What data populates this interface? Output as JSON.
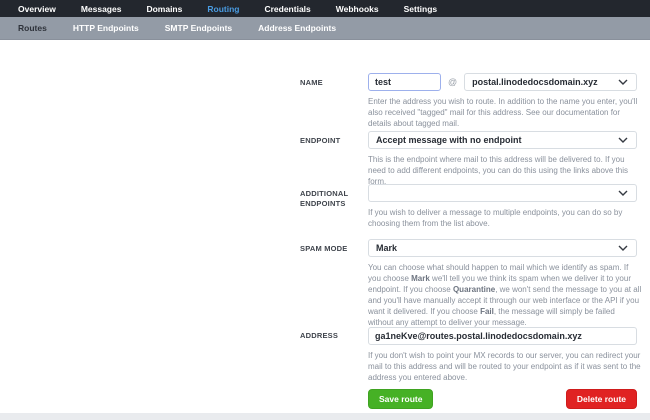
{
  "nav": {
    "tabs": [
      {
        "label": "Overview",
        "active": false
      },
      {
        "label": "Messages",
        "active": false
      },
      {
        "label": "Domains",
        "active": false
      },
      {
        "label": "Routing",
        "active": true
      },
      {
        "label": "Credentials",
        "active": false
      },
      {
        "label": "Webhooks",
        "active": false
      },
      {
        "label": "Settings",
        "active": false
      }
    ]
  },
  "subnav": {
    "items": [
      {
        "label": "Routes",
        "active": true
      },
      {
        "label": "HTTP Endpoints",
        "active": false
      },
      {
        "label": "SMTP Endpoints",
        "active": false
      },
      {
        "label": "Address Endpoints",
        "active": false
      }
    ]
  },
  "form": {
    "name": {
      "label": "NAME",
      "value": "test",
      "separator": "@",
      "domain": "postal.linodedocsdomain.xyz",
      "help": "Enter the address you wish to route. In addition to the name you enter, you'll also received \"tagged\" mail for this address. See our documentation for details about tagged mail."
    },
    "endpoint": {
      "label": "ENDPOINT",
      "value": "Accept message with no endpoint",
      "help": "This is the endpoint where mail to this address will be delivered to. If you need to add different endpoints, you can do this using the links above this form."
    },
    "additional_endpoints": {
      "label": "ADDITIONAL ENDPOINTS",
      "value": "",
      "help": "If you wish to deliver a message to multiple endpoints, you can do so by choosing them from the list above."
    },
    "spam_mode": {
      "label": "SPAM MODE",
      "value": "Mark",
      "help_parts": [
        {
          "text": "You can choose what should happen to mail which we identify as spam. If you choose "
        },
        {
          "text": "Mark"
        },
        {
          "text": " we'll tell you we think its spam when we deliver it to your endpoint. If you choose "
        },
        {
          "text": "Quarantine"
        },
        {
          "text": ", we won't send the message to you at all and you'll have manually accept it through our web interface or the API if you want it delivered. If you choose "
        },
        {
          "text": "Fail"
        },
        {
          "text": ", the message will simply be failed without any attempt to deliver your message."
        }
      ]
    },
    "address": {
      "label": "ADDRESS",
      "value": "ga1neKve@routes.postal.linodedocsdomain.xyz",
      "help": "If you don't wish to point your MX records to our server, you can redirect your mail to this address and will be routed to your endpoint as if it was sent to the address you entered above."
    }
  },
  "buttons": {
    "save": "Save route",
    "delete": "Delete route"
  },
  "colors": {
    "active_tab_blue": "#4a9ce2",
    "save_green": "#46b125",
    "delete_red": "#e02222",
    "focus_border": "#9db0ec",
    "topnav_bg": "#23272e",
    "subnav_bg": "#939ba6"
  }
}
